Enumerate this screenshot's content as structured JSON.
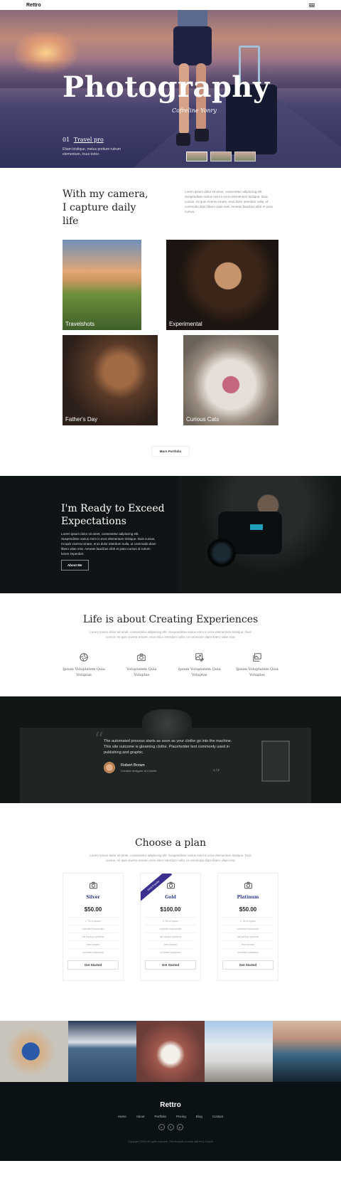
{
  "nav": {
    "brand": "Rettro"
  },
  "hero": {
    "title": "Photography",
    "signature": "Cofreline Yonry",
    "number": "01",
    "link": "Travel pro",
    "text": "Etiam tristique, metus pretium rutrum elementum, risus tortor."
  },
  "intro": {
    "heading": "With my camera, I capture daily life",
    "text": "Lorem ipsum dolor sit amet, consectetur adipiscing elit. Suspendisse varius enim in eros elementum tristique. Duis cursus, mi quis viverra ornare, eros dolor interdum nulla, ut commodo diam libero vitae erat. Aenean faucibus nibh et justo cursus."
  },
  "gallery": {
    "items": [
      {
        "label": "Travelshots"
      },
      {
        "label": "Experimental"
      },
      {
        "label": "Father's Day"
      },
      {
        "label": "Curious Cats"
      }
    ],
    "more_label": "More Portfolio"
  },
  "ready": {
    "heading": "I'm Ready to Exceed Expectations",
    "text": "Lorem ipsum dolor sit amet, consectetur adipiscing elit. Suspendisse varius enim in eros elementum tristique. Duis cursus, mi quis viverra ornare, eros dolor interdum nulla, ut commodo diam libero vitae erat. Aenean faucibus nibh et justo cursus id rutrum lorem imperdiet.",
    "button": "About Me"
  },
  "life": {
    "heading": "Life is about Creating Experiences",
    "text": "Lorem ipsum dolor sit amet, consectetur adipiscing elit. Suspendisse varius enim in eros elementum tristique. Duis cursus, mi quis viverra ornare, eros dolor interdum nulla, ut commodo diam libero vitae erat.",
    "features": [
      {
        "icon": "aperture-icon",
        "label": "Ipsum Voluptatem Quia Voluptas"
      },
      {
        "icon": "camera-icon",
        "label": "Voluptatem Quia Voluptas"
      },
      {
        "icon": "image-edit-icon",
        "label": "Ipsum Voluptatem Quia Voluptas"
      },
      {
        "icon": "images-icon",
        "label": "Ipsum Voluptatem Quia Voluptas"
      }
    ]
  },
  "testimonial": {
    "quote": "The automated process starts as soon as your clothe go into the machine. This site outcome is gleaming clothe. Placeholder text commonly used in publishing and graphic.",
    "name": "Robert Brown",
    "role": "Creative designer at Colorlib",
    "pager": "1 / 2"
  },
  "pricing": {
    "heading": "Choose a plan",
    "text": "Lorem ipsum dolor sit amet, consectetur adipiscing elit. Suspendisse varius enim in eros elementum tristique. Duis cursus, mi quis viverra ornare, eros dolor interdum nulla, ut commodo diam libero vitae erat.",
    "plans": [
      {
        "name": "Silver",
        "price": "$50.00",
        "features": [
          "2 TB of space",
          "unlimited bandwidth",
          "full backup systems",
          "free domain",
          "unlimited database"
        ],
        "cta": "Get Started"
      },
      {
        "name": "Gold",
        "price": "$100.00",
        "badge": "Most Popular",
        "features": [
          "2 TB of space",
          "unlimited bandwidth",
          "full backup systems",
          "free domain",
          "unlimited database"
        ],
        "cta": "Get Started"
      },
      {
        "name": "Platinum",
        "price": "$50.00",
        "features": [
          "2 TB of space",
          "unlimited bandwidth",
          "full backup systems",
          "free domain",
          "unlimited database"
        ],
        "cta": "Get Started"
      }
    ]
  },
  "footer": {
    "brand": "Rettro",
    "links": [
      "Home",
      "About",
      "Portfolio",
      "Pricing",
      "Blog",
      "Contact"
    ],
    "social": [
      "twitter-icon",
      "facebook-icon",
      "pinterest-icon"
    ],
    "copyright": "Copyright ©2022 All rights reserved | This template is made with ♥ by Colorlib"
  }
}
